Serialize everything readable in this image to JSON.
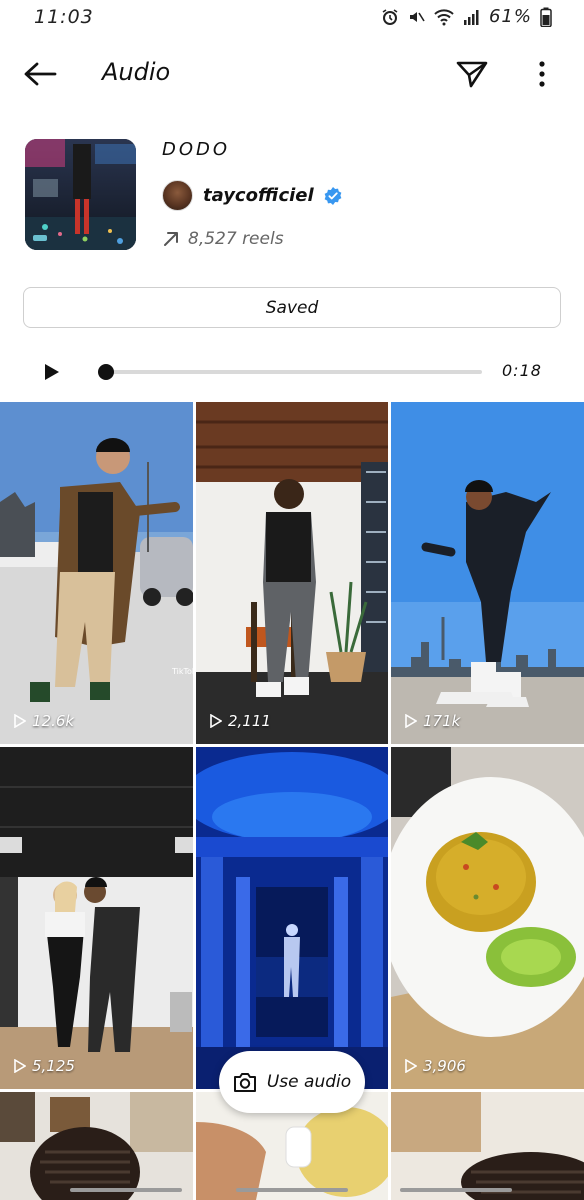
{
  "status_bar": {
    "time": "11:03",
    "battery": "61%"
  },
  "app_bar": {
    "title": "Audio",
    "back_icon": "arrow-left-icon",
    "share_icon": "paper-plane-icon",
    "more_icon": "more-vertical-icon"
  },
  "audio": {
    "title": "DODO",
    "artist": "taycofficiel",
    "verified": true,
    "reels_count": "8,527 reels",
    "trend_icon": "trending-arrow-icon"
  },
  "saved_button": {
    "label": "Saved"
  },
  "player": {
    "state": "paused",
    "play_icon": "play-icon",
    "progress": 0,
    "duration": "0:18"
  },
  "reels": [
    {
      "views": "12.6k",
      "watermark": "TikTok"
    },
    {
      "views": "2,111"
    },
    {
      "views": "171k"
    },
    {
      "views": "5,125"
    },
    {
      "views": ""
    },
    {
      "views": "3,906"
    },
    {
      "views": ""
    },
    {
      "views": ""
    },
    {
      "views": ""
    }
  ],
  "use_audio": {
    "label": "Use audio",
    "icon": "camera-icon"
  },
  "colors": {
    "verified_blue": "#3897f0",
    "progress_track": "#d9d9d9",
    "progress_fill": "#111111"
  }
}
